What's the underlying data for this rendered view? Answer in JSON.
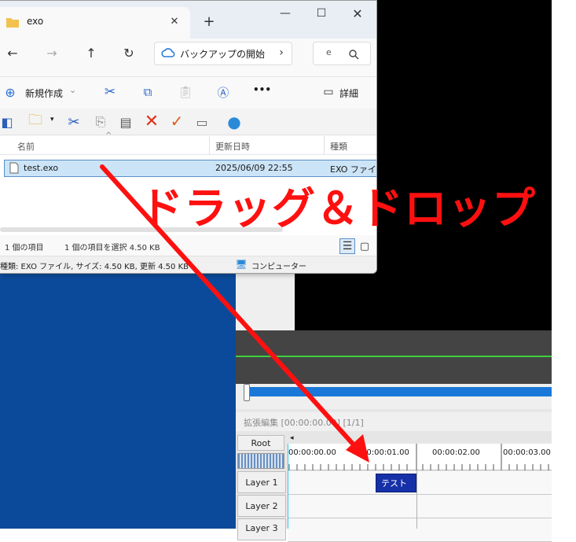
{
  "explorer": {
    "tab_title": "exo",
    "new_tab": "+",
    "window_controls": {
      "minimize": "—",
      "maximize": "☐",
      "close": "✕"
    },
    "tab_close": "✕",
    "nav": {
      "back": "←",
      "forward": "→",
      "up": "↑",
      "refresh": "↻"
    },
    "address": "バックアップの開始",
    "address_chevron": "›",
    "search_text": "e",
    "command_bar": {
      "new_label": "新規作成",
      "new_chevron": "⌄",
      "more": "•••",
      "details_label": "詳細"
    },
    "columns": {
      "name": "名前",
      "date": "更新日時",
      "type": "種類"
    },
    "file": {
      "name": "test.exo",
      "date": "2025/06/09 22:55",
      "type": "EXO ファイル"
    },
    "status": {
      "count": "1 個の項目",
      "selected": "1 個の項目を選択 4.50 KB"
    },
    "info": {
      "details": "種類: EXO ファイル, サイズ: 4.50 KB, 更新 4.50 KB",
      "computer": "コンピューター"
    }
  },
  "overlay_text": "ドラッグ＆ドロップ",
  "timeline": {
    "title": "拡張編集 [00:00:00.00] [1/1]",
    "root_label": "Root",
    "ruler_marks": [
      "00:00:00.00",
      "00:00:01.00",
      "00:00:02.00",
      "00:00:03.00"
    ],
    "layers": [
      "Layer 1",
      "Layer 2",
      "Layer 3"
    ],
    "clip_label": "テスト"
  },
  "colors": {
    "accent_red": "#ff1010",
    "clip_blue": "#1630a8",
    "seek_blue": "#1a78d8",
    "desktop_blue": "#0b4a9a"
  }
}
